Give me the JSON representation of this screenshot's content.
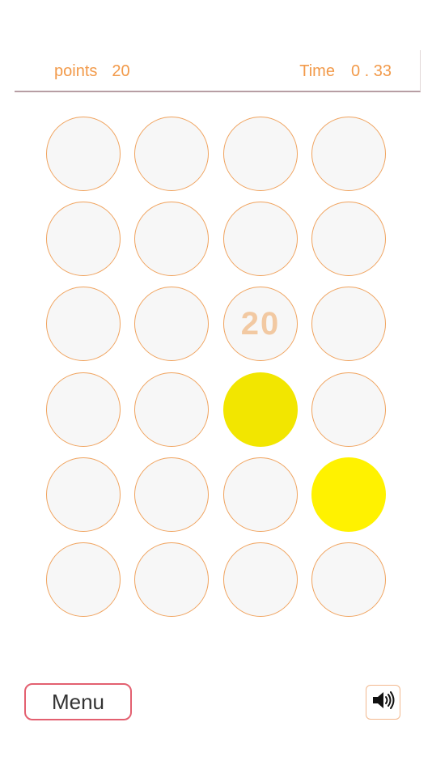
{
  "header": {
    "points_label": "points",
    "points_value": "20",
    "time_label": "Time",
    "time_value": "0 . 33"
  },
  "grid": {
    "rows": 6,
    "columns": 4,
    "cells": [
      {
        "text": "",
        "fill": null
      },
      {
        "text": "",
        "fill": null
      },
      {
        "text": "",
        "fill": null
      },
      {
        "text": "",
        "fill": null
      },
      {
        "text": "",
        "fill": null
      },
      {
        "text": "",
        "fill": null
      },
      {
        "text": "",
        "fill": null
      },
      {
        "text": "",
        "fill": null
      },
      {
        "text": "",
        "fill": null
      },
      {
        "text": "",
        "fill": null
      },
      {
        "text": "20",
        "fill": null
      },
      {
        "text": "",
        "fill": null
      },
      {
        "text": "",
        "fill": null
      },
      {
        "text": "",
        "fill": null
      },
      {
        "text": "",
        "fill": "#f2e600"
      },
      {
        "text": "",
        "fill": null
      },
      {
        "text": "",
        "fill": null
      },
      {
        "text": "",
        "fill": null
      },
      {
        "text": "",
        "fill": null
      },
      {
        "text": "",
        "fill": "#fff200"
      },
      {
        "text": "",
        "fill": null
      },
      {
        "text": "",
        "fill": null
      },
      {
        "text": "",
        "fill": null
      },
      {
        "text": "",
        "fill": null
      }
    ]
  },
  "footer": {
    "menu_label": "Menu",
    "sound_icon": "speaker-icon"
  },
  "colors": {
    "accent": "#f29a4a",
    "circle_border": "#f0a35e",
    "menu_border": "#e36070"
  }
}
